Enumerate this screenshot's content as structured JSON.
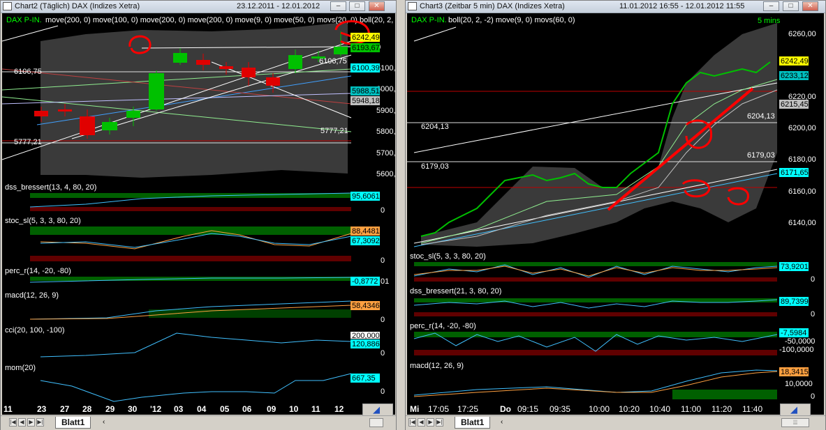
{
  "left_window": {
    "title": "Chart2 (Täglich)   DAX (Indizes Xetra)",
    "date_range": "23.12.2011 - 12.01.2012",
    "main_label_name": "DAX P-IN.",
    "main_label_rest": " move(200, 0) move(100, 0) move(200, 0) move(200, 0) move(9, 0) move(50, 0) movs(20, 0) boll(20, 2, -2)",
    "price_labels": [
      "6106,75",
      "5777,21",
      "6106,75",
      "5777,21"
    ],
    "price_axis": [
      "6100,00",
      "6000,00",
      "5900,00",
      "5800,00",
      "5700,00",
      "5600,00"
    ],
    "price_axis_top": "00",
    "price_badges": [
      {
        "text": "6242,49",
        "bg": "#ffff00",
        "fg": "#000000"
      },
      {
        "text": "6193,67",
        "bg": "#00c000",
        "fg": "#000000"
      },
      {
        "text": "6100,39",
        "bg": "#00ffff",
        "fg": "#000000"
      },
      {
        "text": "5988,51",
        "bg": "#00c0c0",
        "fg": "#000000"
      },
      {
        "text": "5948,18",
        "bg": "#c0c0c0",
        "fg": "#000000"
      }
    ],
    "panels": [
      {
        "label": "dss_bressert(13, 4, 80, 20)",
        "badge": "95,6061",
        "badge_bg": "#00ffff",
        "zero": "0"
      },
      {
        "label": "stoc_sl(5, 3, 3, 80, 20)",
        "badge": "88,4481",
        "badge_bg": "#ffa040",
        "badge2": "67,3092",
        "badge2_bg": "#00ffff",
        "zero": "0"
      },
      {
        "label": "perc_r(14, -20, -80)",
        "badge": "-0,8772",
        "badge_bg": "#00ffff",
        "badge_suffix": "01"
      },
      {
        "label": "macd(12, 26, 9)",
        "badge": "58,4346",
        "badge_bg": "#ffa040",
        "zero": "0"
      },
      {
        "label": "cci(20, 100, -100)",
        "badge": "200,0000",
        "badge_bg": "#ffffff",
        "badge2": "120,8864",
        "badge2_bg": "#00ffff",
        "zero": "0"
      },
      {
        "label": "mom(20)",
        "badge": "667,35",
        "badge_bg": "#00ffff",
        "zero": "0"
      }
    ],
    "x_labels": [
      "11",
      "23",
      "27",
      "28",
      "29",
      "30",
      "'12",
      "03",
      "04",
      "05",
      "06",
      "09",
      "10",
      "11",
      "12"
    ],
    "sheet_tab": "Blatt1"
  },
  "right_window": {
    "title": "Chart3 (Zeitbar 5 min)   DAX (Indizes Xetra)",
    "date_range": "11.01.2012 16:55 - 12.01.2012 11:55",
    "main_label_name": "DAX P-IN.",
    "main_label_rest": " boll(20, 2, -2) move(9, 0) movs(60, 0)",
    "timeframe": "5 mins",
    "price_labels": [
      "6204,13",
      "6204,13",
      "6179,03",
      "6179,03"
    ],
    "price_axis": [
      "6260,00",
      "6220,00",
      "6200,00",
      "6180,00",
      "6160,00",
      "6140,00"
    ],
    "price_badges": [
      {
        "text": "6242,49",
        "bg": "#ffff00",
        "fg": "#000000"
      },
      {
        "text": "6233,12",
        "bg": "#00c0c0",
        "fg": "#000000"
      },
      {
        "text": "6215,45",
        "bg": "#c0c0c0",
        "fg": "#000000"
      },
      {
        "text": "6171,65",
        "bg": "#00ffff",
        "fg": "#000000"
      }
    ],
    "panels": [
      {
        "label": "stoc_sl(5, 3, 3, 80, 20)",
        "badge": "73,9201",
        "badge_bg": "#00ffff",
        "zero": "0"
      },
      {
        "label": "dss_bressert(21, 3, 80, 20)",
        "badge": "89,7399",
        "badge_bg": "#00ffff",
        "zero": "0"
      },
      {
        "label": "perc_r(14, -20, -80)",
        "badge": "-7,5984",
        "badge_bg": "#00ffff",
        "ticks": [
          "-50,0000",
          "-100,0000"
        ]
      },
      {
        "label": "macd(12, 26, 9)",
        "badge": "18,3415",
        "badge_bg": "#ffa040",
        "tick": "10,0000",
        "zero": "0"
      }
    ],
    "x_labels": [
      "Mi",
      "17:05",
      "17:25",
      "Do",
      "09:15",
      "09:35",
      "10:00",
      "10:20",
      "10:40",
      "11:00",
      "11:20",
      "11:40"
    ],
    "sheet_tab": "Blatt1"
  },
  "colors": {
    "bull": "#00c000",
    "bear": "#e00000",
    "axis_text": "#ffffff",
    "label_text": "#ffffff",
    "annotation": "#ff0000"
  }
}
